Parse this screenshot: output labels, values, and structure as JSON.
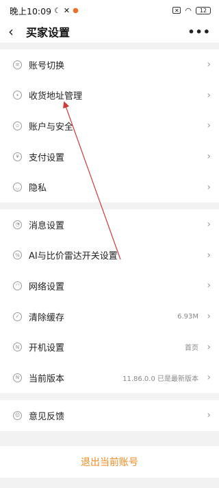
{
  "status_bar": {
    "time": "晚上10:09",
    "battery": "12"
  },
  "header": {
    "title": "买家设置"
  },
  "groups": [
    {
      "items": [
        {
          "label": "账号切换"
        },
        {
          "label": "收货地址管理"
        },
        {
          "label": "账户与安全"
        },
        {
          "label": "支付设置"
        },
        {
          "label": "隐私"
        }
      ]
    },
    {
      "items": [
        {
          "label": "消息设置"
        },
        {
          "label": "AI与比价雷达开关设置"
        },
        {
          "label": "网络设置"
        },
        {
          "label": "清除缓存",
          "value": "6.93M"
        },
        {
          "label": "开机设置",
          "value": "首页"
        },
        {
          "label": "当前版本",
          "value": "11.86.0.0  已是最新版本"
        }
      ]
    },
    {
      "items": [
        {
          "label": "意见反馈"
        }
      ]
    }
  ],
  "logout": {
    "label": "退出当前账号"
  },
  "colors": {
    "accent": "#f08b22",
    "annotation_arrow": "#d23a3a"
  }
}
